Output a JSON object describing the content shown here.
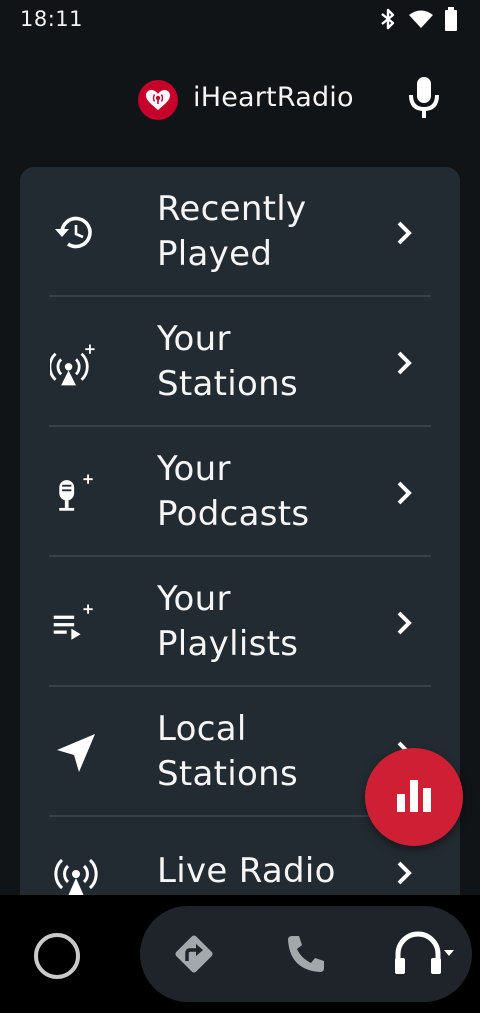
{
  "status_bar": {
    "time": "18:11",
    "icons": [
      "bluetooth-icon",
      "wifi-icon",
      "battery-icon"
    ]
  },
  "header": {
    "app_name": "iHeartRadio",
    "logo_color": "#c6002b"
  },
  "menu": {
    "items": [
      {
        "label": "Recently\nPlayed",
        "line1": "Recently",
        "line2": "Played",
        "icon": "history-icon"
      },
      {
        "label": "Your\nStations",
        "line1": "Your",
        "line2": "Stations",
        "icon": "radio-station-add-icon"
      },
      {
        "label": "Your\nPodcasts",
        "line1": "Your",
        "line2": "Podcasts",
        "icon": "podcast-mic-add-icon"
      },
      {
        "label": "Your\nPlaylists",
        "line1": "Your",
        "line2": "Playlists",
        "icon": "playlist-add-icon"
      },
      {
        "label": "Local\nStations",
        "line1": "Local",
        "line2": "Stations",
        "icon": "navigation-arrow-icon"
      },
      {
        "label": "Live Radio",
        "line1": "Live Radio",
        "line2": "",
        "icon": "live-radio-icon"
      }
    ]
  },
  "fab": {
    "icon": "equalizer-icon",
    "color": "#cf1f35"
  },
  "bottom_nav": {
    "items": [
      "home-circle-icon",
      "navigation-icon",
      "phone-icon",
      "headphones-icon"
    ]
  }
}
